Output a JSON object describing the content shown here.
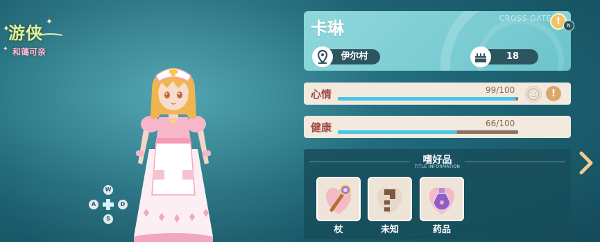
{
  "badge": {
    "title": "游侠",
    "subtitle": "和蔼可亲"
  },
  "dpad": {
    "up": "W",
    "left": "A",
    "right": "D",
    "down": "S"
  },
  "profile": {
    "name": "卡琳",
    "watermark": "CROSS GATE",
    "location": "伊尔村",
    "age": "18",
    "n_badge": "N",
    "info_icon": "exclamation-icon"
  },
  "stats": {
    "mood": {
      "label": "心情",
      "value": "99/100",
      "fraction": 0.99
    },
    "health": {
      "label": "健康",
      "value": "66/100",
      "fraction": 0.66
    }
  },
  "hobbies": {
    "title": "嗜好品",
    "subtitle": "TITLE INFORMATION",
    "items": [
      {
        "label": "杖",
        "icon": "staff-icon"
      },
      {
        "label": "未知",
        "icon": "question-mark-icon"
      },
      {
        "label": "药品",
        "icon": "potion-icon"
      }
    ]
  },
  "colors": {
    "bar_fill": "#46c7e6",
    "card_bg": "#7ccfd5",
    "label_red": "#a14a43"
  }
}
